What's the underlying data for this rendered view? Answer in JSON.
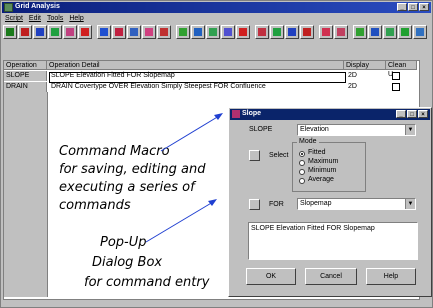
{
  "window": {
    "title": "Grid Analysis",
    "btn_min": "_",
    "btn_max": "□",
    "btn_close": "×"
  },
  "menu": {
    "items": [
      "Script",
      "Edit",
      "Tools",
      "Help"
    ]
  },
  "table": {
    "headers": [
      "Operation",
      "Operation Detail",
      "Display",
      "Clean Up"
    ],
    "rows": [
      {
        "operation": "SLOPE",
        "detail": "SLOPE Elevation Fitted FOR Slopemap",
        "display": "2D"
      },
      {
        "operation": "DRAIN",
        "detail": "DRAIN Covertype OVER Elevation Simply Steepest FOR Confluence",
        "display": "2D"
      }
    ]
  },
  "annotation_macro": [
    "Command Macro",
    "for saving, editing and",
    "executing a series of",
    "commands"
  ],
  "annotation_dialog": [
    "Pop-Up",
    "Dialog Box",
    "for command entry"
  ],
  "dialog": {
    "title": "Slope",
    "slope_label": "SLOPE",
    "slope_value": "Elevation",
    "select_label": "Select",
    "mode_label": "Mode",
    "modes": [
      "Fitted",
      "Maximum",
      "Minimum",
      "Average"
    ],
    "selected_mode": "Fitted",
    "for_label": "FOR",
    "for_value": "Slopemap",
    "command_text": "SLOPE Elevation Fitted FOR Slopemap",
    "ok_label": "OK",
    "cancel_label": "Cancel",
    "help_label": "Help"
  },
  "colors": {
    "title_bar": "#0a246a",
    "arrow": "#1f3fd1"
  }
}
